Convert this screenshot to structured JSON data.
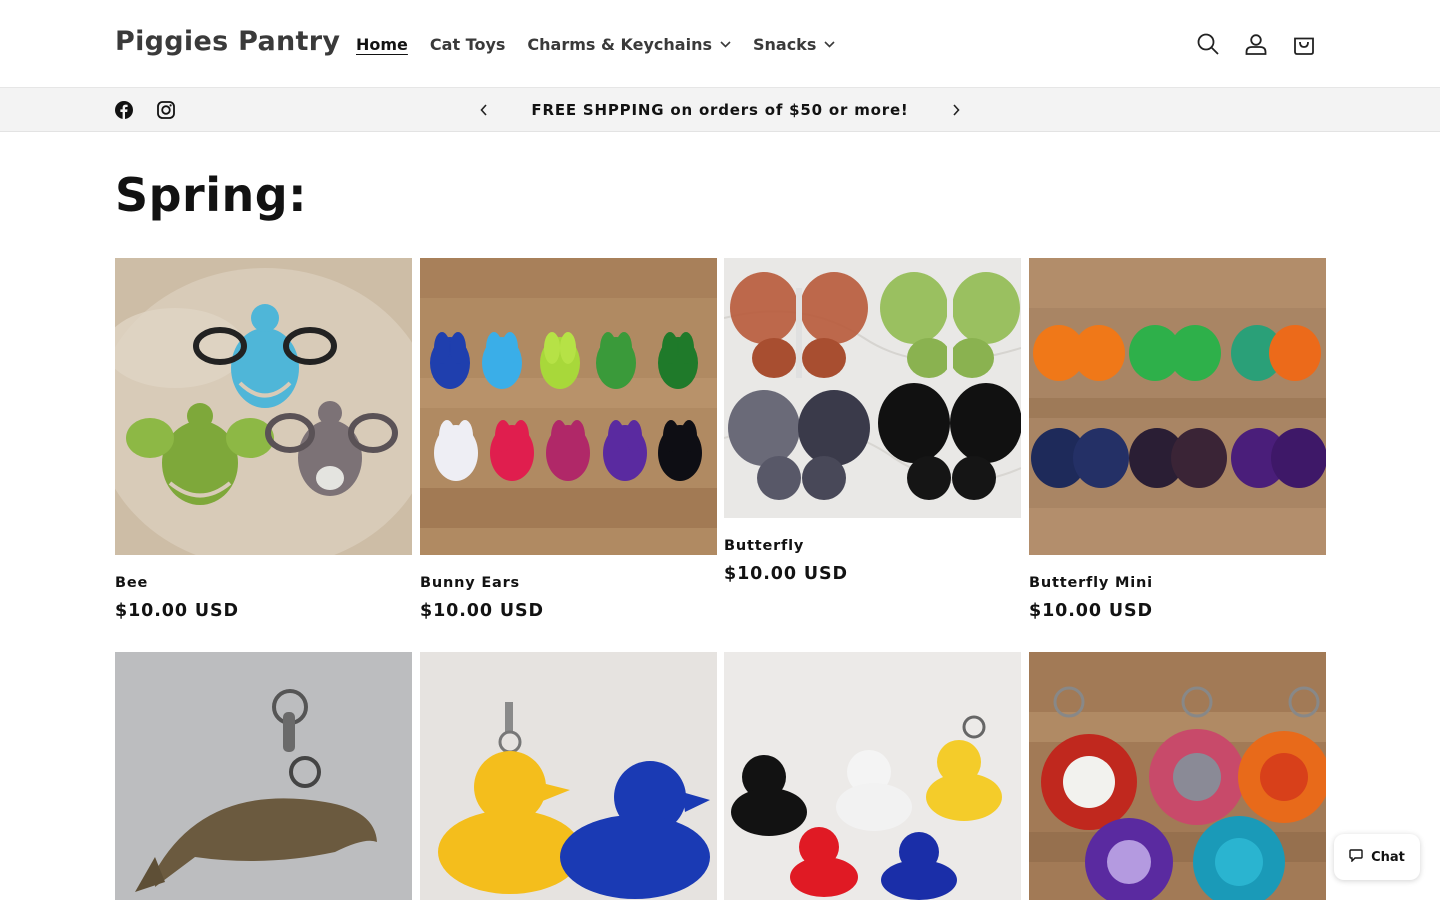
{
  "brand": {
    "name": "Piggies Pantry"
  },
  "nav": {
    "items": [
      {
        "label": "Home",
        "active": true
      },
      {
        "label": "Cat Toys"
      },
      {
        "label": "Charms & Keychains",
        "dropdown": true
      },
      {
        "label": "Snacks",
        "dropdown": true
      }
    ]
  },
  "header_icons": [
    "search-icon",
    "account-icon",
    "cart-icon"
  ],
  "announcement": {
    "text": "FREE SHPPING on orders of $50 or more!"
  },
  "social": [
    "facebook-icon",
    "instagram-icon"
  ],
  "collection": {
    "title": "Spring:"
  },
  "products": [
    {
      "name": "Bee",
      "price": "$10.00 USD"
    },
    {
      "name": "Bunny Ears",
      "price": "$10.00 USD"
    },
    {
      "name": "Butterfly",
      "price": "$10.00 USD"
    },
    {
      "name": "Butterfly Mini",
      "price": "$10.00 USD"
    }
  ],
  "chat": {
    "label": "Chat"
  },
  "colors": {
    "text": "#121212",
    "announcement_bg": "#f3f3f3",
    "nav_text": "#3a3a3a"
  }
}
